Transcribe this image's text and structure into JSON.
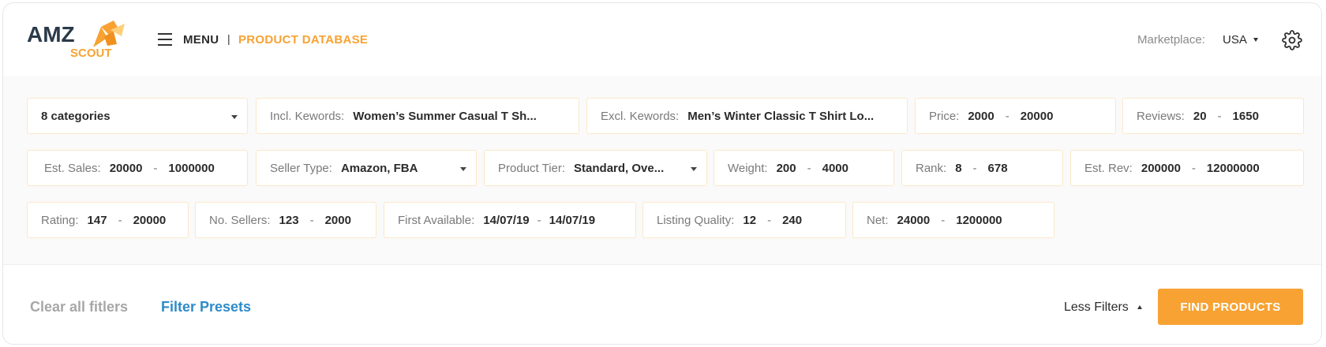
{
  "header": {
    "logo_top": "AMZ",
    "logo_bottom": "SCOUT",
    "menu_label": "MENU",
    "separator": "|",
    "breadcrumb": "PRODUCT DATABASE",
    "marketplace_label": "Marketplace:",
    "marketplace_value": "USA"
  },
  "filters": {
    "categories": "8 categories",
    "incl_keywords": {
      "label": "Incl. Kewords:",
      "value": "Women’s Summer Casual T Sh..."
    },
    "excl_keywords": {
      "label": "Excl. Kewords:",
      "value": "Men’s Winter Classic T Shirt Lo..."
    },
    "price": {
      "label": "Price:",
      "min": "2000",
      "max": "20000"
    },
    "reviews": {
      "label": "Reviews:",
      "min": "20",
      "max": "1650"
    },
    "est_sales": {
      "label": "Est. Sales:",
      "min": "20000",
      "max": "1000000"
    },
    "seller_type": {
      "label": "Seller Type:",
      "value": "Amazon, FBA"
    },
    "product_tier": {
      "label": "Product Tier:",
      "value": "Standard, Ove..."
    },
    "weight": {
      "label": "Weight:",
      "min": "200",
      "max": "4000"
    },
    "rank": {
      "label": "Rank:",
      "min": "8",
      "max": "678"
    },
    "est_rev": {
      "label": "Est. Rev:",
      "min": "200000",
      "max": "12000000"
    },
    "rating": {
      "label": "Rating:",
      "min": "147",
      "max": "20000"
    },
    "no_sellers": {
      "label": "No. Sellers:",
      "min": "123",
      "max": "2000"
    },
    "first_available": {
      "label": "First Available:",
      "min": "14/07/19",
      "max": "14/07/19"
    },
    "listing_quality": {
      "label": "Listing Quality:",
      "min": "12",
      "max": "240"
    },
    "net": {
      "label": "Net:",
      "min": "24000",
      "max": "1200000"
    },
    "range_dash": "-"
  },
  "footer": {
    "clear_label": "Clear all fitlers",
    "presets_label": "Filter Presets",
    "less_label": "Less Filters",
    "find_label": "FIND PRODUCTS"
  },
  "colors": {
    "accent": "#f7a233",
    "link": "#2e8bc9",
    "brand_dark": "#2b3a4a"
  },
  "icons": {
    "menu": "hamburger-icon",
    "settings": "gear-icon",
    "dropdown": "caret-down-icon"
  }
}
